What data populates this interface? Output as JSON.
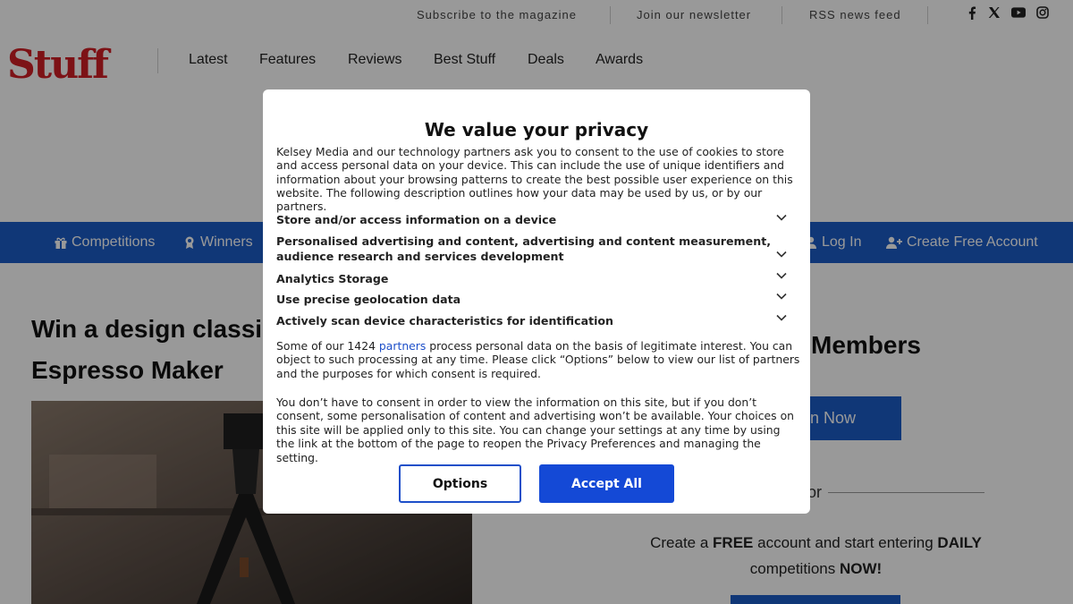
{
  "topbar": {
    "subscribe": "Subscribe to the magazine",
    "newsletter": "Join our newsletter",
    "rss": "RSS news feed",
    "social_icons": [
      "facebook-icon",
      "x-icon",
      "youtube-icon",
      "instagram-icon"
    ]
  },
  "logo": "Stuff",
  "nav": [
    "Latest",
    "Features",
    "Reviews",
    "Best Stuff",
    "Deals",
    "Awards"
  ],
  "bluebar": {
    "competitions": "Competitions",
    "winners": "Winners",
    "login": "Log In",
    "create_account": "Create Free Account"
  },
  "article": {
    "headline_line1": "Win a design classic",
    "headline_line2": "Espresso Maker"
  },
  "sidebar": {
    "members": "Members",
    "join_button": "n Now",
    "or": "or",
    "create_part1": "Create a ",
    "create_free": "FREE",
    "create_part2": " account and start entering ",
    "create_daily": "DAILY",
    "create_part3": "competitions ",
    "create_now": "NOW!"
  },
  "consent": {
    "title": "We value your privacy",
    "intro": "Kelsey Media and our technology partners ask you to consent to the use of cookies to store and access personal data on your device. This can include the use of unique identifiers and information about your browsing patterns to create the best possible user experience on this website. The following description outlines how your data may be used by us, or by our partners.",
    "purposes": [
      "Store and/or access information on a device",
      "Personalised advertising and content, advertising and content measurement, audience research and services development",
      "Analytics Storage",
      "Use precise geolocation data",
      "Actively scan device characteristics for identification"
    ],
    "legit_part1": "Some of our 1424 ",
    "legit_link": "partners",
    "legit_part2": " process personal data on the basis of legitimate interest. You can object to such processing at any time. Please click “Options” below to view our list of partners and the purposes for which consent is required.",
    "no_consent": "You don’t have to consent in order to view the information on this site, but if you don’t consent, some personalisation of content and advertising won’t be available. Your choices on this site will be applied only to this site. You can change your settings at any time by using the link at the bottom of the page to reopen the Privacy Preferences and managing the setting.",
    "options_button": "Options",
    "accept_button": "Accept All"
  },
  "colors": {
    "brand_red": "#d11f26",
    "nav_blue": "#1c5cc7",
    "accept_blue": "#1449d6",
    "link_blue": "#1d4fc9"
  }
}
